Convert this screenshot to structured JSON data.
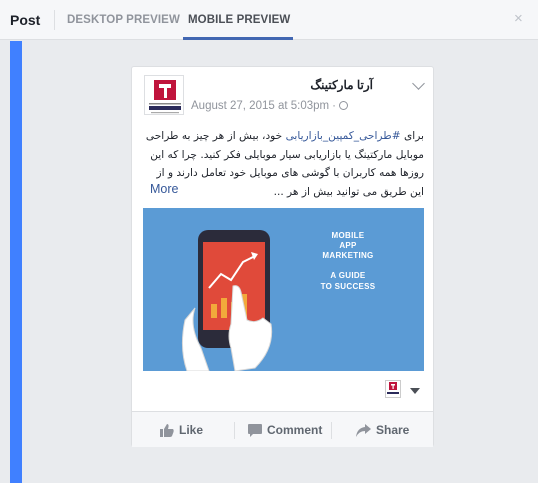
{
  "header": {
    "post_label": "Post",
    "tabs": [
      {
        "label": "DESKTOP PREVIEW"
      },
      {
        "label": "MOBILE PREVIEW"
      }
    ],
    "close_glyph": "×"
  },
  "post": {
    "page_name": "آرتا مارکتینگ",
    "timestamp": "August 27, 2015 at 5:03pm",
    "meta_sep": "·",
    "text_prefix": "برای ",
    "hashtag": "#طراحی_کمپین_بازاریابی",
    "text_rest": " خود، بیش از هر چیز به طراحی موبایل مارکتینگ یا بازاریابی سیار موبایلی فکر کنید. چرا که این روزها همه کاربران با گوشی های موبایل خود تعامل دارند و از این طریق می توانید بیش از هر ...",
    "more_label": "More",
    "image": {
      "line1": "MOBILE",
      "line2": "APP",
      "line3": "MARKETING",
      "line4": "A GUIDE",
      "line5": "TO SUCCESS"
    }
  },
  "actions": {
    "like": "Like",
    "comment": "Comment",
    "share": "Share"
  },
  "colors": {
    "accent": "#4080ff",
    "link": "#365899",
    "image_bg": "#5b9bd5"
  }
}
